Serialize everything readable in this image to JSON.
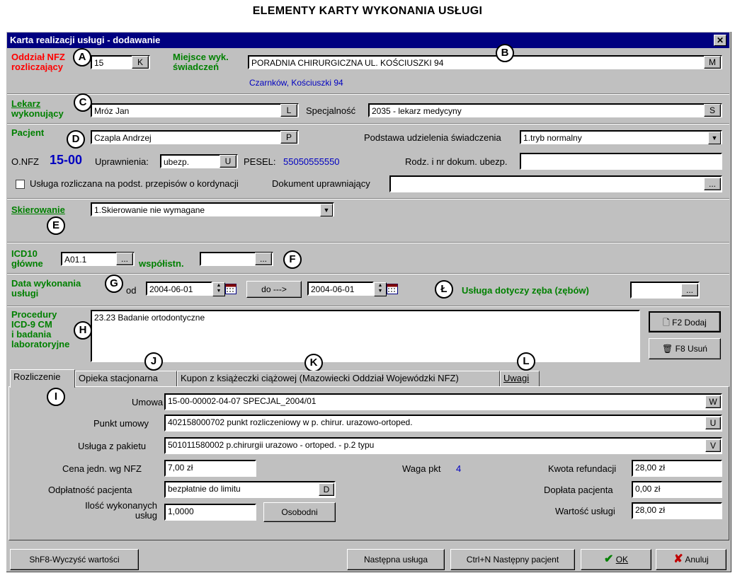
{
  "page_header": "ELEMENTY KARTY WYKONANIA USŁUGI",
  "window": {
    "title": "Karta realizacji usługi - dodawanie",
    "close_glyph": "✕"
  },
  "markers": {
    "A": "A",
    "B": "B",
    "C": "C",
    "D": "D",
    "E": "E",
    "F": "F",
    "G": "G",
    "H": "H",
    "I": "I",
    "J": "J",
    "K": "K",
    "L": "L",
    "L2": "Ł"
  },
  "oddzial": {
    "label_1": "Oddział NFZ",
    "label_2": "rozliczający",
    "value": "15",
    "button": "K"
  },
  "miejsce": {
    "label_1": "Miejsce wyk.",
    "label_2": "świadczeń",
    "value": "PORADNIA CHIRURGICZNA UL. KOŚCIUSZKI 94",
    "button": "M",
    "address": "Czarnków, Kościuszki 94"
  },
  "lekarz": {
    "label_1": "Lekarz",
    "label_2": "wykonujący",
    "value": "Mróz Jan",
    "button": "L"
  },
  "specjalnosc": {
    "label": "Specjalność",
    "value": "2035 - lekarz medycyny",
    "button": "S"
  },
  "pacjent": {
    "label": "Pacjent",
    "value": "Czapla Andrzej",
    "button": "P"
  },
  "podstawa": {
    "label": "Podstawa udzielenia świadczenia",
    "value": "1.tryb normalny"
  },
  "onfz": {
    "label": "O.NFZ",
    "value": "15-00"
  },
  "uprawnienia": {
    "label": "Uprawnienia:",
    "value": "ubezp.",
    "button": "U"
  },
  "pesel": {
    "label": "PESEL:",
    "value": "55050555550"
  },
  "rodz_dokum": {
    "label": "Rodz. i nr dokum. ubezp.",
    "value": ""
  },
  "koordynacja": {
    "label": "Usługa rozliczana na podst. przepisów o kordynacji",
    "checked": false
  },
  "dokument": {
    "label": "Dokument uprawniający",
    "value": "",
    "button": "..."
  },
  "skierowanie": {
    "label": "Skierowanie",
    "value": "1.Skierowanie nie wymagane"
  },
  "icd10": {
    "label_1": "ICD10",
    "label_2": "główne",
    "value": "A01.1",
    "button": "...",
    "wspolistn_label": "współistn.",
    "wspolistn_value": "",
    "wspolistn_button": "..."
  },
  "data": {
    "label_1": "Data wykonania",
    "label_2": "usługi",
    "od_label": "od",
    "od_value": "2004-06-01",
    "do_button": "do --->",
    "do_value": "2004-06-01"
  },
  "zab": {
    "label": "Usługa dotyczy zęba (zębów)",
    "value": "",
    "button": "..."
  },
  "procedury": {
    "label_1": "Procedury",
    "label_2": "ICD-9 CM",
    "label_3": "i badania",
    "label_4": "laboratoryjne",
    "items": [
      "23.23 Badanie ortodontyczne"
    ],
    "add_button": "F2 Dodaj",
    "remove_button": "F8 Usuń"
  },
  "tabs": [
    {
      "label": "Rozliczenie",
      "active": true
    },
    {
      "label": "Opieka stacjonarna",
      "active": false
    },
    {
      "label": "Kupon z  książeczki ciążowej (Mazowiecki Oddział Wojewódzki NFZ)",
      "active": false
    },
    {
      "label": "Uwagi",
      "active": false
    }
  ],
  "rozliczenie": {
    "umowa": {
      "label": "Umowa",
      "value": "15-00-00002-04-07  SPECJAL_2004/01",
      "button": "W"
    },
    "punkt": {
      "label": "Punkt umowy",
      "value": "402158000702 punkt rozliczeniowy w p. chirur. urazowo-ortoped.",
      "button": "U"
    },
    "pakiet": {
      "label": "Usługa z pakietu",
      "value": "501011580002 p.chirurgii urazowo - ortoped. - p.2 typu",
      "button": "V"
    },
    "cena": {
      "label": "Cena jedn. wg NFZ",
      "value": "7,00 zł"
    },
    "waga": {
      "label": "Waga pkt",
      "value": "4"
    },
    "kwota": {
      "label": "Kwota refundacji",
      "value": "28,00 zł"
    },
    "odplatnosc": {
      "label": "Odpłatność pacjenta",
      "value": "bezpłatnie do limitu",
      "button": "D"
    },
    "doplata": {
      "label": "Dopłata pacjenta",
      "value": "0,00 zł"
    },
    "ilosc": {
      "label_1": "Ilość wykonanych",
      "label_2": "usług",
      "value": "1,0000",
      "button": "Osobodni"
    },
    "wartosc": {
      "label": "Wartość usługi",
      "value": "28,00 zł"
    }
  },
  "footer": {
    "clear": "ShF8-Wyczyść wartości",
    "next_service": "Następna usługa",
    "next_patient": "Ctrl+N Następny pacjent",
    "ok": "OK",
    "cancel": "Anuluj"
  },
  "colors": {
    "title_bar": "#000080",
    "window_bg": "#c0c0c0",
    "label_red": "#ff0000",
    "label_green": "#008000",
    "value_blue": "#0000c0"
  }
}
